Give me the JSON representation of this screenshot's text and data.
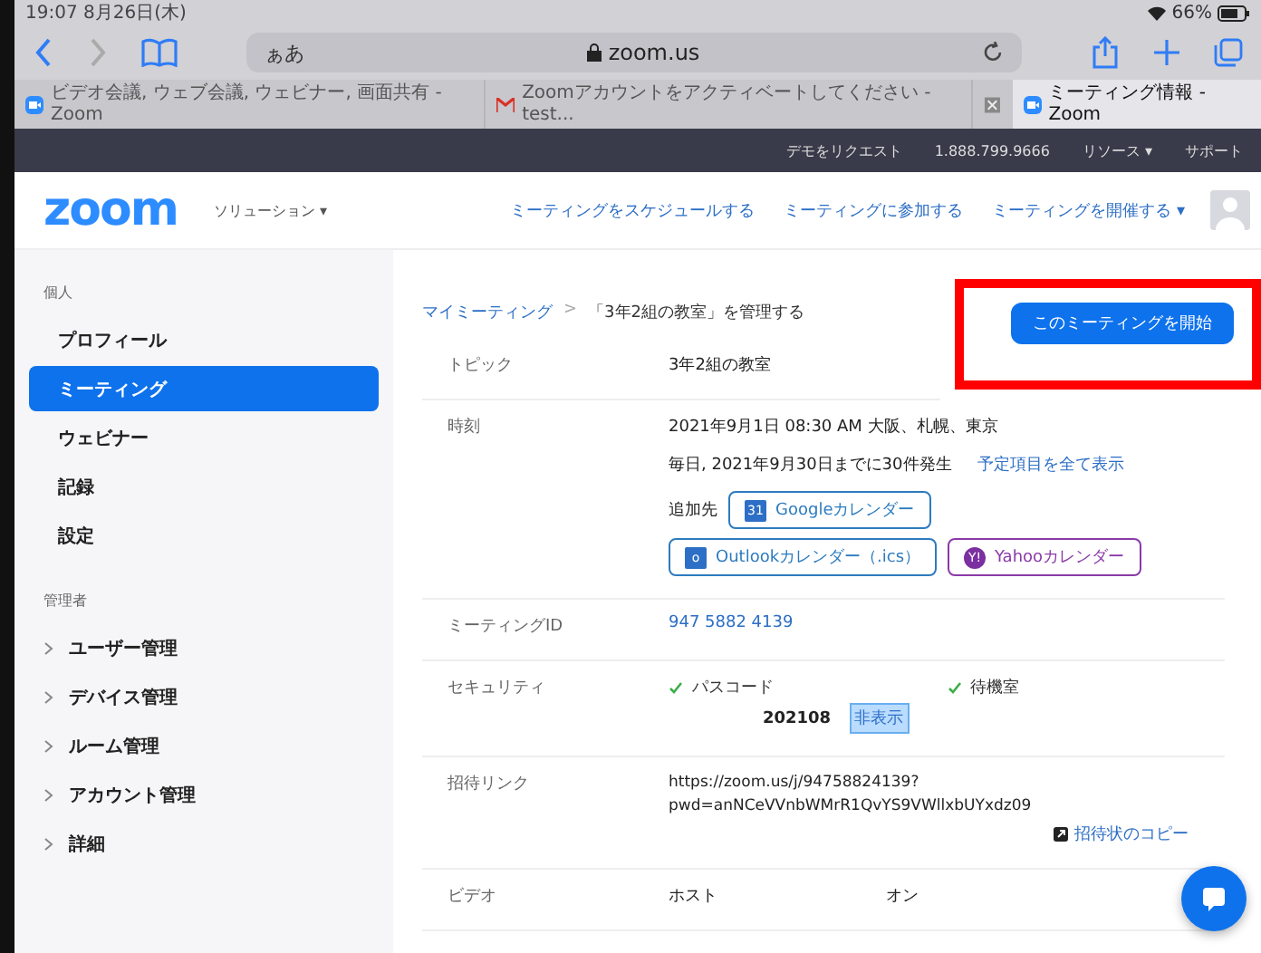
{
  "status_bar": {
    "time": "19:07  8月26日(木)",
    "battery": "66%"
  },
  "browser": {
    "address_prefix": "ぁあ",
    "address": "zoom.us",
    "tabs": [
      {
        "label": "ビデオ会議, ウェブ会議, ウェビナー, 画面共有 - Zoom",
        "kind": "zoom",
        "selected": false
      },
      {
        "label": "Zoomアカウントをアクティベートしてください - test...",
        "kind": "mail",
        "selected": false
      },
      {
        "label": "ミーティング情報 - Zoom",
        "kind": "zoom",
        "selected": true
      }
    ]
  },
  "top_bar": [
    "デモをリクエスト",
    "1.888.799.9666",
    "リソース ▾",
    "サポート"
  ],
  "header": {
    "logo": "zoom",
    "solutions": "ソリューション ▾",
    "nav": [
      "ミーティングをスケジュールする",
      "ミーティングに参加する",
      "ミーティングを開催する ▾"
    ]
  },
  "sidebar": {
    "sections": [
      {
        "title": "個人",
        "items": [
          {
            "label": "プロフィール",
            "selected": false,
            "expandable": false
          },
          {
            "label": "ミーティング",
            "selected": true,
            "expandable": false
          },
          {
            "label": "ウェビナー",
            "selected": false,
            "expandable": false
          },
          {
            "label": "記録",
            "selected": false,
            "expandable": false
          },
          {
            "label": "設定",
            "selected": false,
            "expandable": false
          }
        ]
      },
      {
        "title": "管理者",
        "items": [
          {
            "label": "ユーザー管理",
            "selected": false,
            "expandable": true
          },
          {
            "label": "デバイス管理",
            "selected": false,
            "expandable": true
          },
          {
            "label": "ルーム管理",
            "selected": false,
            "expandable": true
          },
          {
            "label": "アカウント管理",
            "selected": false,
            "expandable": true
          },
          {
            "label": "詳細",
            "selected": false,
            "expandable": true
          }
        ]
      }
    ]
  },
  "breadcrumb": {
    "parent": "マイミーティング",
    "separator": ">",
    "current": "「3年2組の教室」を管理する"
  },
  "start_button": {
    "label": "このミーティングを開始",
    "highlighted": true
  },
  "rows": [
    {
      "kind": "text",
      "label": "トピック",
      "value": "3年2組の教室"
    },
    {
      "kind": "time",
      "label": "時刻",
      "value": "2021年9月1日 08:30 AM 大阪、札幌、東京",
      "recurrence": "毎日, 2021年9月30日までに30件発生",
      "link": "予定項目を全て表示",
      "add_to": "追加先",
      "calendars": [
        {
          "kind": "google",
          "label": "Googleカレンダー",
          "icon_text": "31",
          "color": "#2d7bbf"
        },
        {
          "kind": "outlook",
          "label": "Outlookカレンダー（.ics）",
          "icon_text": "o",
          "color": "#2d7bbf"
        },
        {
          "kind": "yahoo",
          "label": "Yahooカレンダー",
          "icon_text": "Y!",
          "color": "#8a3aa8"
        }
      ]
    },
    {
      "kind": "link",
      "label": "ミーティングID",
      "value": "947 5882 4139"
    },
    {
      "kind": "security",
      "label": "セキュリティ",
      "passcode_label": "パスコード",
      "passcode_checked": true,
      "passcode": "202108",
      "hide": "非表示",
      "waiting_label": "待機室",
      "waiting_checked": true
    },
    {
      "kind": "invite",
      "label": "招待リンク",
      "value": "https://zoom.us/j/94758824139?\npwd=anNCeVVnbWMrR1QvYS9VWllxbUYxdz09",
      "copy": "招待状のコピー"
    },
    {
      "kind": "video",
      "label": "ビデオ",
      "sub_label": "ホスト",
      "value": "オン"
    }
  ]
}
